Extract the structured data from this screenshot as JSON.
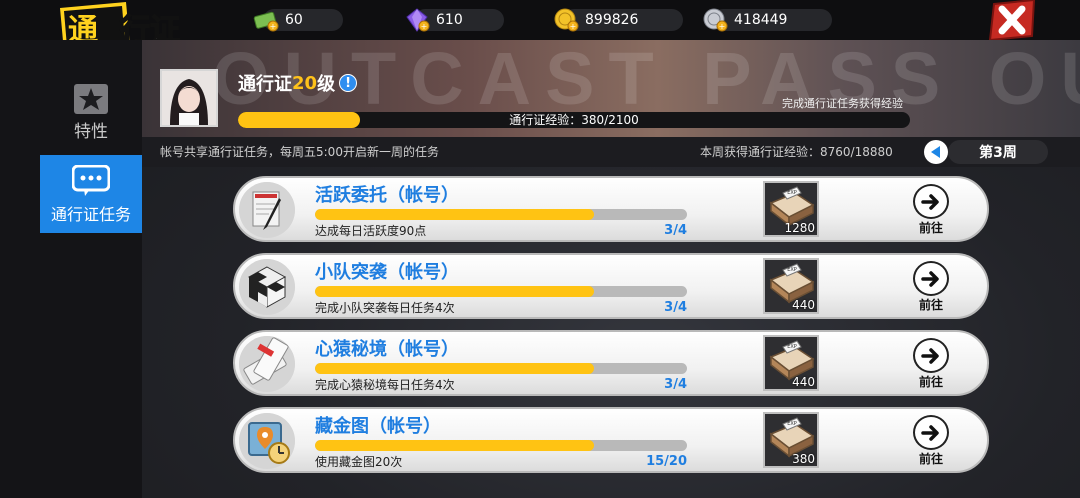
{
  "header": {
    "title": "通行证",
    "resources": [
      {
        "icon": "cash-icon",
        "value": "60"
      },
      {
        "icon": "purple-gem-icon",
        "value": "610"
      },
      {
        "icon": "gold-coin-icon",
        "value": "899826"
      },
      {
        "icon": "silver-coin-icon",
        "value": "418449"
      }
    ]
  },
  "sidebar": {
    "items": [
      {
        "label": "特性",
        "icon": "star-icon",
        "active": false
      },
      {
        "label": "通行证任务",
        "icon": "chat-bubble-icon",
        "active": true
      }
    ]
  },
  "banner": {
    "background_text": "OUTCAST PASS OUT",
    "title_prefix": "通行证",
    "level": "20",
    "title_suffix": "级",
    "hint": "完成通行证任务获得经验",
    "exp_label": "通行证经验：380/2100",
    "exp_current": 380,
    "exp_max": 2100
  },
  "strip": {
    "left_text": "帐号共享通行证任务，每周五5:00开启新一周的任务",
    "weekly_exp": "本周获得通行证经验：8760/18880",
    "week_label": "第3周"
  },
  "tasks": [
    {
      "name": "活跃委托（帐号）",
      "desc": "达成每日活跃度90点",
      "progress": "3/4",
      "fraction": 0.75,
      "reward": "1280",
      "reward_icon": "exp-book-icon",
      "go_label": "前往",
      "icon": "document-pen-icon"
    },
    {
      "name": "小队突袭（帐号）",
      "desc": "完成小队突袭每日任务4次",
      "progress": "3/4",
      "fraction": 0.75,
      "reward": "440",
      "reward_icon": "exp-book-icon",
      "go_label": "前往",
      "icon": "checker-cube-icon"
    },
    {
      "name": "心猿秘境（帐号）",
      "desc": "完成心猿秘境每日任务4次",
      "progress": "3/4",
      "fraction": 0.75,
      "reward": "440",
      "reward_icon": "exp-book-icon",
      "go_label": "前往",
      "icon": "ticket-icon"
    },
    {
      "name": "藏金图（帐号）",
      "desc": "使用藏金图20次",
      "progress": "15/20",
      "fraction": 0.75,
      "reward": "380",
      "reward_icon": "exp-book-icon",
      "go_label": "前往",
      "icon": "treasure-map-icon"
    }
  ],
  "colors": {
    "accent": "#1e86e6",
    "progress": "#ffc313",
    "task_title": "#1f7ee0",
    "close": "#c62a22"
  }
}
